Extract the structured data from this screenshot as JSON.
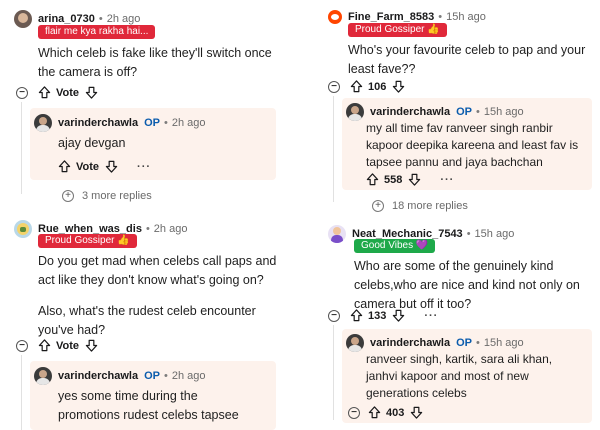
{
  "left": {
    "thread1": {
      "username": "arina_0730",
      "time": "2h ago",
      "flair": "flair me kya rakha hai...",
      "body": "Which celeb is fake like they'll switch once the camera is off?",
      "vote_label": "Vote",
      "reply": {
        "username": "varinderchawla",
        "op": "OP",
        "time": "2h ago",
        "body": "ajay devgan",
        "vote_label": "Vote"
      },
      "more_replies": "3 more replies"
    },
    "thread2": {
      "username": "Rue_when_was_dis",
      "time": "2h ago",
      "flair": "Proud Gossiper 👍",
      "body_p1": "Do you get mad when celebs call paps and act like they don't know what's going on?",
      "body_p2": "Also, what's the rudest celeb encounter you've had?",
      "vote_label": "Vote",
      "reply": {
        "username": "varinderchawla",
        "op": "OP",
        "time": "2h ago",
        "body": "yes some time during the promotions rudest celebs tapsee"
      }
    }
  },
  "right": {
    "thread1": {
      "username": "Fine_Farm_8583",
      "time": "15h ago",
      "flair": "Proud Gossiper 👍",
      "body": "Who's your favourite celeb to pap and your least fave??",
      "score": "106",
      "reply": {
        "username": "varinderchawla",
        "op": "OP",
        "time": "15h ago",
        "body": "my all time fav ranveer singh ranbir kapoor deepika kareena and least fav is tapsee pannu and jaya bachchan",
        "score": "558"
      },
      "more_replies": "18 more replies"
    },
    "thread2": {
      "username": "Neat_Mechanic_7543",
      "time": "15h ago",
      "flair": "Good Vibes 💜",
      "body": "Who are some of the genuinely kind celebs,who are nice and kind not only on camera but off it too?",
      "score": "133",
      "reply": {
        "username": "varinderchawla",
        "op": "OP",
        "time": "15h ago",
        "body": "ranveer singh, kartik, sara ali khan, janhvi kapoor and most of new generations celebs",
        "score": "403"
      }
    }
  },
  "colors": {
    "flair_red": "#e0283a",
    "flair_green": "#1ea94a",
    "op_blue": "#0b5cad",
    "reply_bg": "#fdf2ec"
  },
  "icons": [
    "upvote-icon",
    "downvote-icon",
    "collapse-icon",
    "more-options-icon",
    "expand-replies-icon",
    "avatar"
  ]
}
